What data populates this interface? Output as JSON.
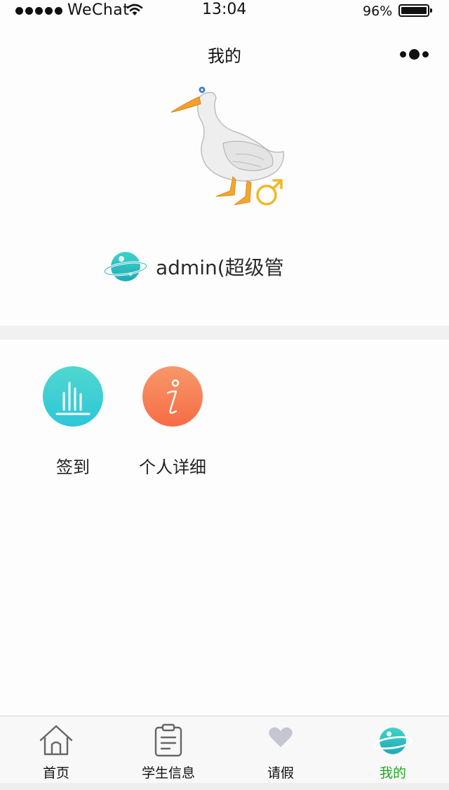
{
  "status_bar": {
    "carrier": "WeChat",
    "time": "13:04",
    "battery": "96%",
    "battery_level": 0.96
  },
  "nav": {
    "title": "我的",
    "menu_icon": "more-dots-icon"
  },
  "profile": {
    "avatar_icon": "goose-avatar",
    "gender_icon": "male-symbol-icon",
    "badge_icon": "planet-icon",
    "username": "admin(超级管"
  },
  "shortcuts": [
    {
      "label": "签到",
      "icon": "bar-chart-icon",
      "color": "#3fcfd6"
    },
    {
      "label": "个人详细",
      "icon": "info-icon",
      "color": "#f7804f"
    }
  ],
  "tabs": [
    {
      "label": "首页",
      "icon": "home-icon",
      "active": false
    },
    {
      "label": "学生信息",
      "icon": "clipboard-icon",
      "active": false
    },
    {
      "label": "请假",
      "icon": "heart-icon",
      "active": false
    },
    {
      "label": "我的",
      "icon": "planet-icon",
      "active": true
    }
  ],
  "colors": {
    "active_tab": "#1aad19",
    "accent_teal": "#2ebfc0",
    "accent_orange": "#f7804f"
  }
}
